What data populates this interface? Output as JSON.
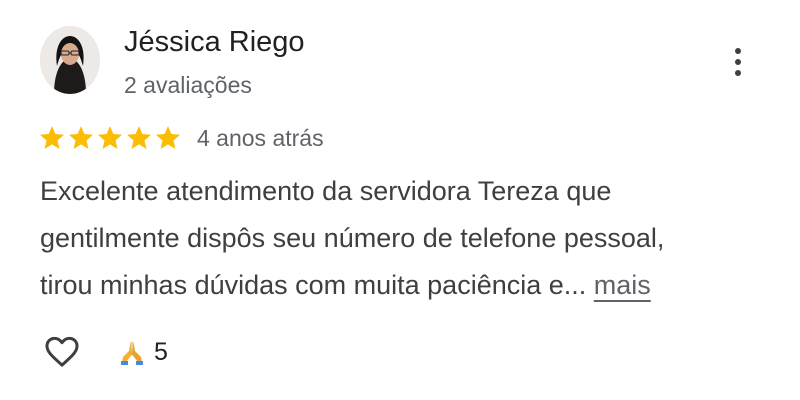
{
  "review": {
    "author": {
      "name": "Jéssica Riego",
      "review_count": "2 avaliações",
      "avatar_icon": "user-photo"
    },
    "menu_icon": "more-vert-icon",
    "rating": 5,
    "max_rating": 5,
    "star_color": "#FBBC04",
    "date": "4 anos atrás",
    "text_lines": [
      "Excelente atendimento da servidora Tereza que",
      "gentilmente dispôs seu número de telefone pessoal,",
      "tirou minhas dúvidas com muita paciência e..."
    ],
    "more_label": "mais",
    "actions": {
      "like_icon": "heart-outline-icon",
      "reaction_icon": "folded-hands-icon",
      "reaction_count": "5"
    }
  }
}
